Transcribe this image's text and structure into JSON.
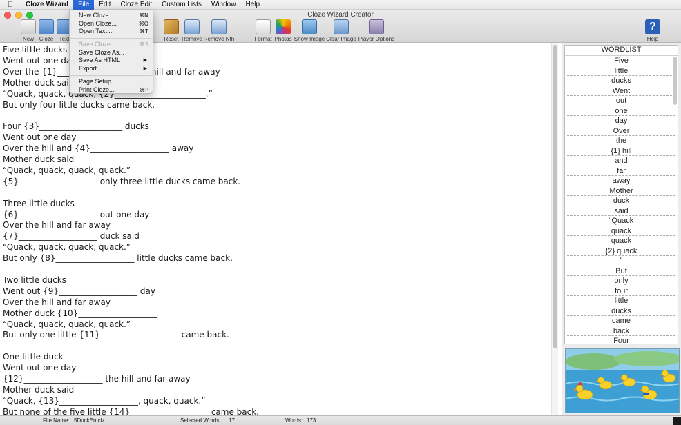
{
  "menubar": {
    "apple_icon": "apple-logo",
    "items": [
      "Cloze Wizard",
      "File",
      "Edit",
      "Cloze Edit",
      "Custom Lists",
      "Window",
      "Help"
    ],
    "active": "File"
  },
  "window": {
    "title": "Cloze Wizard Creator"
  },
  "toolbar": {
    "new": "New",
    "cloze": "Cloze",
    "text": "Text",
    "reset": "Reset",
    "remove": "Remove",
    "remove_nth": "Remove Nth",
    "format": "Format",
    "photos": "Photos",
    "show_image": "Show Image",
    "clear_image": "Clear Image",
    "player_options": "Player Options",
    "help": "Help",
    "help_glyph": "?"
  },
  "file_menu": {
    "new_cloze": "New Cloze",
    "new_cloze_sc": "⌘N",
    "open_cloze": "Open Cloze...",
    "open_cloze_sc": "⌘O",
    "open_text": "Open Text...",
    "open_text_sc": "⌘T",
    "save_cloze": "Save Cloze...",
    "save_cloze_sc": "⌘S",
    "save_cloze_as": "Save Cloze As...",
    "save_as_html": "Save As HTML",
    "export": "Export",
    "page_setup": "Page Setup...",
    "print_cloze": "Print Cloze...",
    "print_cloze_sc": "⌘P"
  },
  "editor": {
    "lines": [
      "Five little ducks",
      "Went out one day",
      "Over the {1}______________________ hill and far away",
      "Mother duck said",
      "“Quack, quack, quack, {2}______________________.”",
      "But only four little ducks came back.",
      "",
      "Four {3}____________________ ducks",
      "Went out one day",
      "Over the hill and {4}___________________ away",
      "Mother duck said",
      "“Quack, quack, quack, quack.”",
      "{5}___________________ only three little ducks came back.",
      "",
      "Three little ducks",
      "{6}___________________ out one day",
      "Over the hill and far away",
      "{7}___________________ duck said",
      "“Quack, quack, quack, quack.”",
      "But only {8}___________________ little ducks came back.",
      "",
      "Two little ducks",
      "Went out {9}___________________ day",
      "Over the hill and far away",
      "Mother duck {10}___________________",
      "“Quack, quack, quack, quack.”",
      "But only one little {11}___________________ came back.",
      "",
      "One little duck",
      "Went out one day",
      "{12}___________________ the hill and far away",
      "Mother duck said",
      "“Quack, {13}___________________, quack, quack.”",
      "But none of the five little {14}___________________ came back."
    ]
  },
  "wordlist": {
    "header": "WORDLIST",
    "items": [
      "Five",
      "little",
      "ducks",
      "Went",
      "out",
      "one",
      "day",
      "Over",
      "the",
      "{1} hill",
      "and",
      "far",
      "away",
      "Mother",
      "duck",
      "said",
      "“Quack",
      "quack",
      "quack",
      "{2} quack",
      "”",
      "But",
      "only",
      "four",
      "little",
      "ducks",
      "came",
      "back",
      "Four"
    ]
  },
  "status": {
    "file_name_label": "File Name:",
    "file_name": "5DuckEn.clz",
    "selected_label": "Selected Words:",
    "selected": "17",
    "words_label": "Words:",
    "words": "173"
  }
}
